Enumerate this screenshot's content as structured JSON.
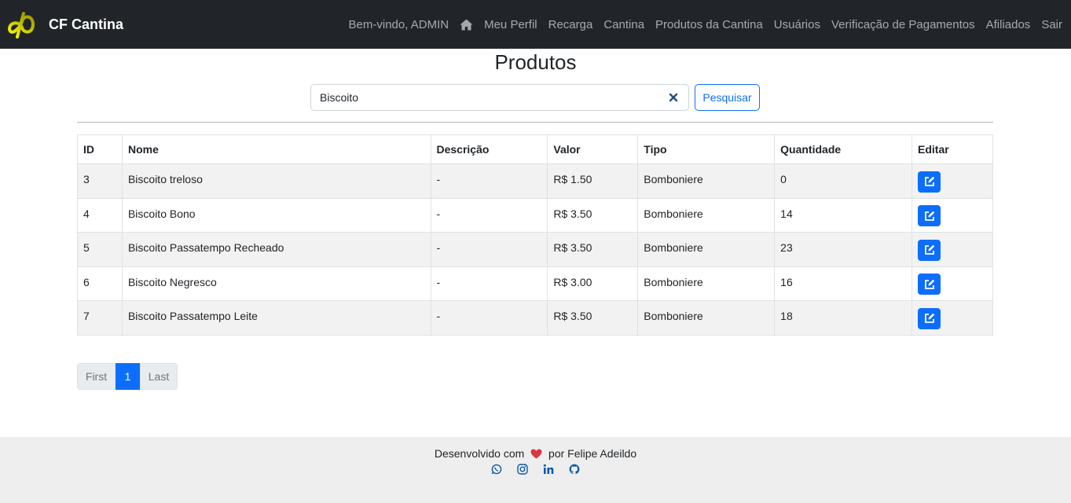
{
  "navbar": {
    "brand": "CF Cantina",
    "welcome": "Bem-vindo, ADMIN",
    "home_icon": "home-icon",
    "links": [
      "Meu Perfil",
      "Recarga",
      "Cantina",
      "Produtos da Cantina",
      "Usuários",
      "Verificação de Pagamentos",
      "Afiliados",
      "Sair"
    ]
  },
  "page": {
    "title": "Produtos"
  },
  "search": {
    "value": "Biscoito",
    "button": "Pesquisar",
    "clear_icon": "close-icon"
  },
  "table": {
    "headers": [
      "ID",
      "Nome",
      "Descrição",
      "Valor",
      "Tipo",
      "Quantidade",
      "Editar"
    ],
    "rows": [
      {
        "id": "3",
        "nome": "Biscoito treloso",
        "descricao": "-",
        "valor": "R$ 1.50",
        "tipo": "Bomboniere",
        "quantidade": "0"
      },
      {
        "id": "4",
        "nome": "Biscoito Bono",
        "descricao": "-",
        "valor": "R$ 3.50",
        "tipo": "Bomboniere",
        "quantidade": "14"
      },
      {
        "id": "5",
        "nome": "Biscoito Passatempo Recheado",
        "descricao": "-",
        "valor": "R$ 3.50",
        "tipo": "Bomboniere",
        "quantidade": "23"
      },
      {
        "id": "6",
        "nome": "Biscoito Negresco",
        "descricao": "-",
        "valor": "R$ 3.00",
        "tipo": "Bomboniere",
        "quantidade": "16"
      },
      {
        "id": "7",
        "nome": "Biscoito Passatempo Leite",
        "descricao": "-",
        "valor": "R$ 3.50",
        "tipo": "Bomboniere",
        "quantidade": "18"
      }
    ],
    "edit_icon": "edit-icon"
  },
  "pagination": {
    "first": "First",
    "current": "1",
    "last": "Last"
  },
  "footer": {
    "text_before": "Desenvolvido com",
    "heart_icon": "heart-icon",
    "text_after": "por Felipe Adeildo",
    "social_icons": [
      "whatsapp-icon",
      "instagram-icon",
      "linkedin-icon",
      "github-icon"
    ]
  },
  "colors": {
    "navbar": "#212529",
    "primary": "#0d6efd",
    "footer": "#eeeeee",
    "heart": "#dc3545",
    "logo": "#e5e500"
  }
}
